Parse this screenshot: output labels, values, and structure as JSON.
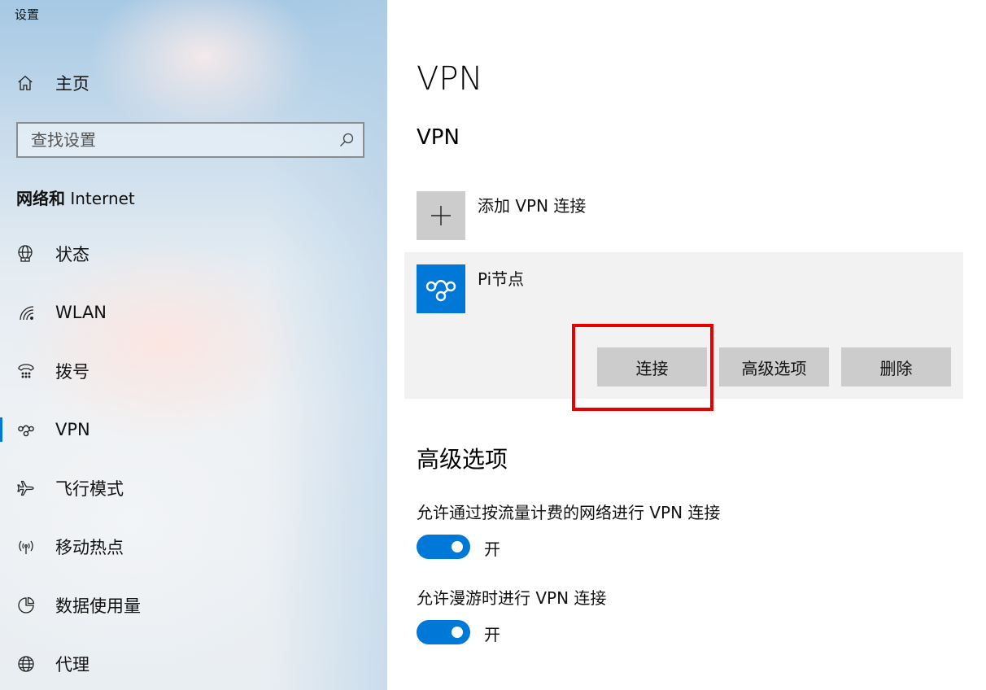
{
  "window": {
    "title": "设置"
  },
  "sidebar": {
    "home_label": "主页",
    "search_placeholder": "查找设置",
    "section_title_bold": "网络和",
    "section_title_rest": " Internet",
    "items": [
      {
        "label": "状态",
        "icon": "status-globe-icon",
        "active": false
      },
      {
        "label": "WLAN",
        "icon": "wifi-icon",
        "active": false
      },
      {
        "label": "拨号",
        "icon": "dial-up-icon",
        "active": false
      },
      {
        "label": "VPN",
        "icon": "vpn-icon",
        "active": true
      },
      {
        "label": "飞行模式",
        "icon": "airplane-icon",
        "active": false
      },
      {
        "label": "移动热点",
        "icon": "hotspot-icon",
        "active": false
      },
      {
        "label": "数据使用量",
        "icon": "data-usage-icon",
        "active": false
      },
      {
        "label": "代理",
        "icon": "proxy-globe-icon",
        "active": false
      }
    ]
  },
  "main": {
    "page_title": "VPN",
    "section_title": "VPN",
    "add_vpn_label": "添加 VPN 连接",
    "vpn_connection": {
      "name": "Pi节点",
      "connect_label": "连接",
      "advanced_label": "高级选项",
      "delete_label": "删除"
    },
    "advanced_title": "高级选项",
    "options": [
      {
        "label": "允许通过按流量计费的网络进行 VPN 连接",
        "state": "开",
        "on": true
      },
      {
        "label": "允许漫游时进行 VPN 连接",
        "state": "开",
        "on": true
      }
    ]
  },
  "colors": {
    "accent": "#0078d7",
    "button_gray": "#cccccc",
    "card_background": "#f2f2f2",
    "highlight_red": "#e60000"
  }
}
